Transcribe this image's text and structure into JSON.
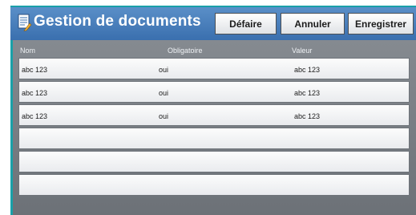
{
  "header": {
    "title": "Gestion de documents",
    "buttons": {
      "defaire": "Défaire",
      "annuler": "Annuler",
      "enregistrer": "Enregistrer"
    },
    "icon": "document-edit-icon"
  },
  "table": {
    "columns": [
      "Nom",
      "Obligatoire",
      "Valeur"
    ],
    "rows": [
      [
        "abc 123",
        "oui",
        "abc 123"
      ],
      [
        "abc 123",
        "oui",
        "abc 123"
      ],
      [
        "abc 123",
        "oui",
        "abc 123"
      ],
      [
        "",
        "",
        ""
      ],
      [
        "",
        "",
        ""
      ],
      [
        "",
        "",
        ""
      ]
    ]
  },
  "colors": {
    "titlebar": "#3a6fae",
    "accent": "#1aa0a8",
    "panel": "#7c8187"
  }
}
